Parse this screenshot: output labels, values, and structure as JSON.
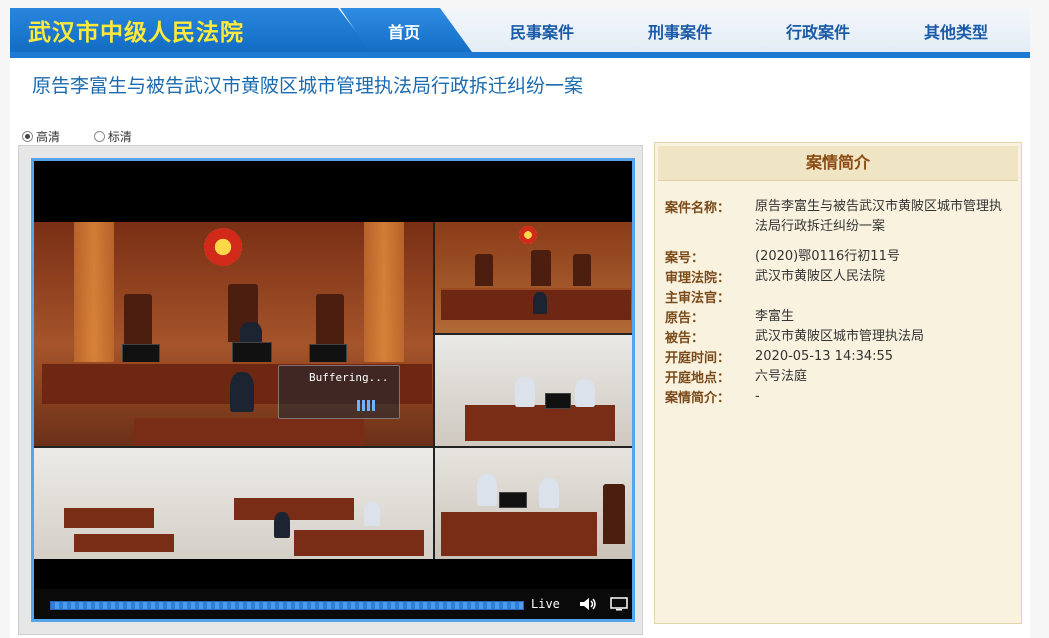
{
  "header": {
    "site_title": "武汉市中级人民法院",
    "nav": {
      "home": "首页",
      "civil": "民事案件",
      "criminal": "刑事案件",
      "administrative": "行政案件",
      "other": "其他类型"
    }
  },
  "case_title": "原告李富生与被告武汉市黄陂区城市管理执法局行政拆迁纠纷一案",
  "quality": {
    "hd": "高清",
    "sd": "标清",
    "selected": "高清"
  },
  "player": {
    "buffering": "Buffering...",
    "live": "Live",
    "progress_fraction": 1.0
  },
  "info": {
    "header": "案情简介",
    "rows": [
      {
        "label": "案件名称：",
        "value": "原告李富生与被告武汉市黄陂区城市管理执法局行政拆迁纠纷一案"
      },
      {
        "label": "案号：",
        "value": "(2020)鄂0116行初11号"
      },
      {
        "label": "审理法院：",
        "value": "武汉市黄陂区人民法院"
      },
      {
        "label": "主审法官：",
        "value": ""
      },
      {
        "label": "原告：",
        "value": "李富生"
      },
      {
        "label": "被告：",
        "value": "武汉市黄陂区城市管理执法局"
      },
      {
        "label": "开庭时间：",
        "value": "2020-05-13 14:34:55"
      },
      {
        "label": "开庭地点：",
        "value": "六号法庭"
      },
      {
        "label": "案情简介：",
        "value": "-"
      }
    ]
  }
}
